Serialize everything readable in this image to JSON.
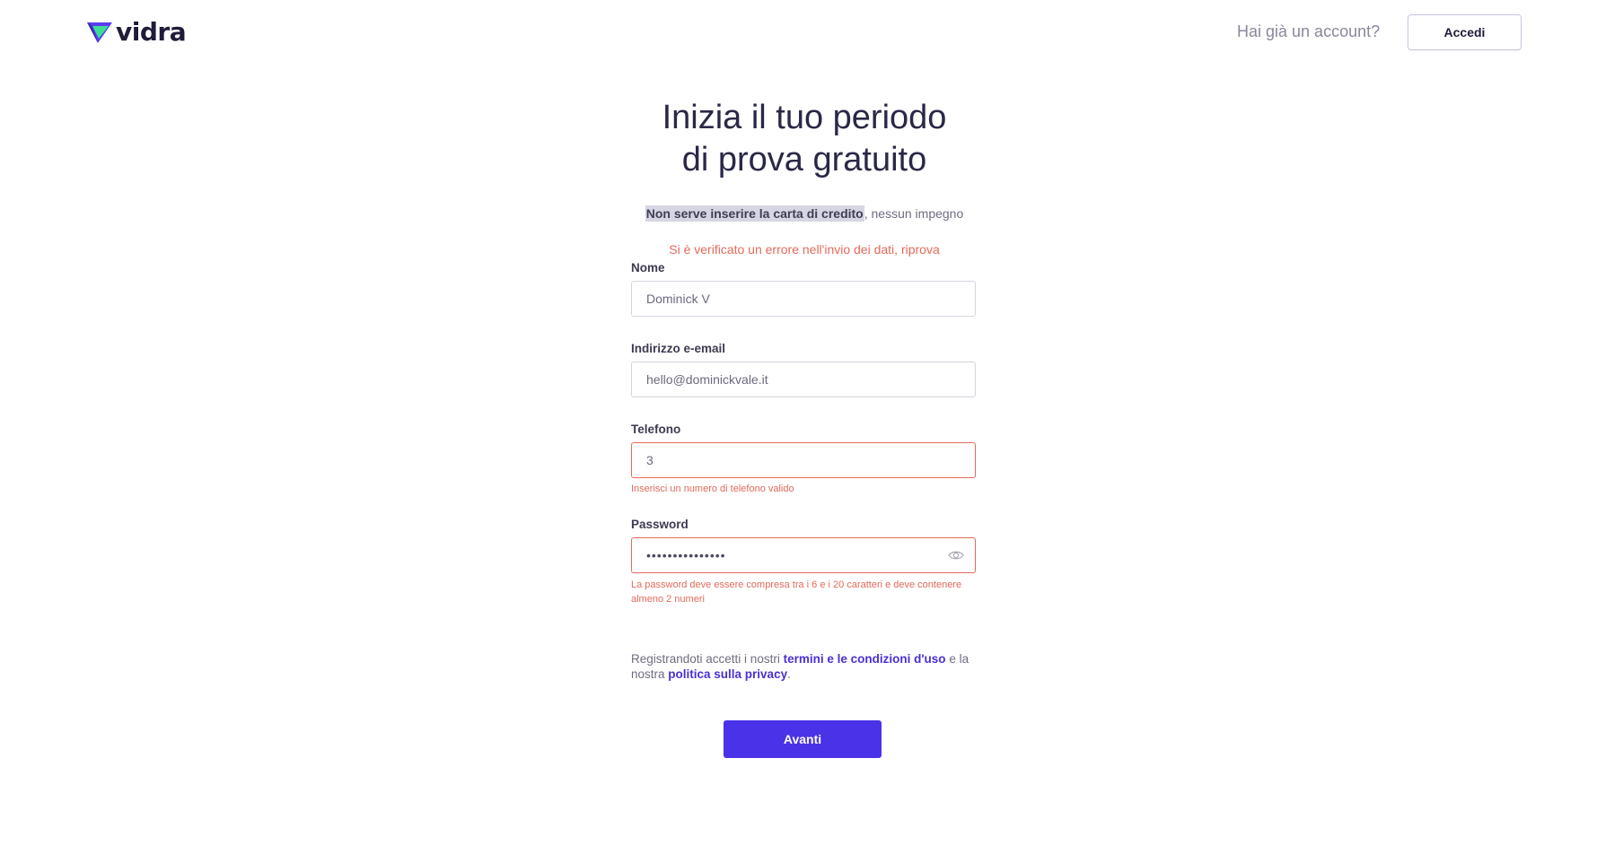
{
  "brand": {
    "name": "vidra",
    "logo_icon": "vidra-triangle-logo",
    "accent": "#4a32e8",
    "logo_green": "#3ddc97",
    "logo_purple": "#5b3cf0"
  },
  "header": {
    "have_account": "Hai già un account?",
    "login_label": "Accedi"
  },
  "main": {
    "title_line1": "Inizia il tuo periodo",
    "title_line2": "di prova gratuito",
    "subtitle_bold": "Non serve inserire la carta di credito",
    "subtitle_rest": ", nessun impegno",
    "global_error": "Si è verificato un errore nell'invio dei dati, riprova"
  },
  "form": {
    "name": {
      "label": "Nome",
      "value": "Dominick V"
    },
    "email": {
      "label": "Indirizzo e-email",
      "value": "hello@dominickvale.it"
    },
    "phone": {
      "label": "Telefono",
      "value": "3",
      "error": "Inserisci un numero di telefono valido"
    },
    "password": {
      "label": "Password",
      "value": "•••••••••••••••",
      "error": "La password deve essere compresa tra i 6 e i 20 caratteri e deve contenere almeno 2 numeri",
      "toggle_icon": "eye-icon"
    },
    "terms": {
      "prefix": "Registrandoti accetti i nostri ",
      "terms_link": "termini e le condizioni d'uso",
      "middle": " e la nostra ",
      "privacy_link": "politica sulla privacy",
      "suffix": "."
    },
    "submit_label": "Avanti"
  },
  "colors": {
    "error": "#e46a5b",
    "link": "#4b2fd6"
  }
}
